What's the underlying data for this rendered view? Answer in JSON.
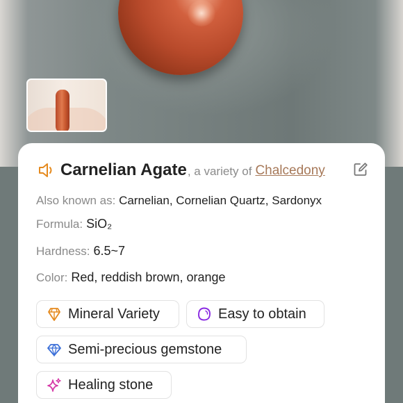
{
  "mineral": {
    "name": "Carnelian Agate",
    "variety_prefix": ", a variety of",
    "variety_of": "Chalcedony"
  },
  "details": {
    "aka_label": "Also known as:",
    "aka_value": "Carnelian, Cornelian Quartz, Sardonyx",
    "formula_label": "Formula:",
    "formula_value": "SiO₂",
    "hardness_label": "Hardness:",
    "hardness_value": "6.5~7",
    "color_label": "Color:",
    "color_value": "Red, reddish brown, orange"
  },
  "tags": [
    {
      "label": "Mineral Variety",
      "icon": "crystal-icon",
      "color": "#e58a1e"
    },
    {
      "label": "Easy to obtain",
      "icon": "stone-icon",
      "color": "#8a2be2"
    },
    {
      "label": "Semi-precious gemstone",
      "icon": "diamond-icon",
      "color": "#3b6fd8"
    },
    {
      "label": "Healing stone",
      "icon": "sparkle-icon",
      "color": "#d63aa8"
    }
  ],
  "colors": {
    "accent": "#e58a1e",
    "link": "#a67858",
    "label_gray": "#8a8a8a"
  },
  "icons": {
    "speaker": "speaker-icon",
    "edit": "edit-icon"
  }
}
